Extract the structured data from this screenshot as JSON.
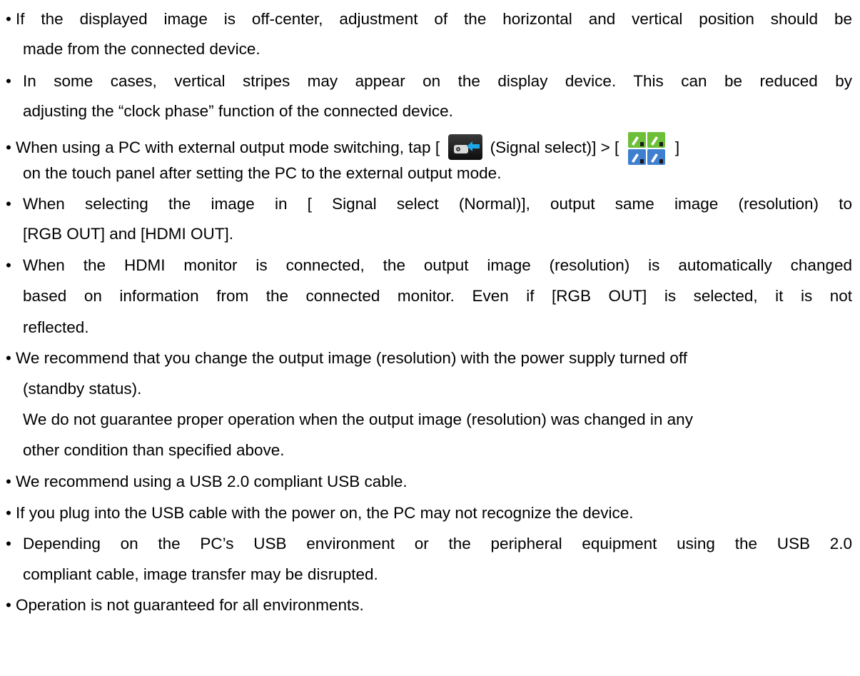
{
  "bullet": "•",
  "items": [
    {
      "lines": [
        "If the displayed image is off-center, adjustment of the horizontal and vertical position should be",
        "made from the connected device."
      ]
    },
    {
      "lines": [
        "In some cases, vertical stripes may appear on the display device. This can be reduced by",
        "adjusting the “clock phase” function of the connected device."
      ]
    },
    {
      "line1_parts": [
        "When using a PC with external output mode switching, tap [",
        "(Signal select)] > [",
        "]"
      ],
      "line2": "on the touch panel after setting the PC to the external output mode.",
      "icons": [
        "signal-select-icon",
        "signal-grid-icon"
      ]
    },
    {
      "lines": [
        "When selecting the image in [ Signal select (Normal)], output same image (resolution) to",
        "[RGB OUT] and [HDMI OUT]."
      ]
    },
    {
      "lines": [
        "When the HDMI monitor is connected, the output image (resolution) is automatically changed",
        "based on information from the connected monitor. Even if [RGB OUT] is selected, it is not",
        "reflected."
      ]
    },
    {
      "lines": [
        "We recommend that you change the output image (resolution) with the power supply turned off",
        "(standby status).",
        "We do not guarantee proper operation when the output image (resolution) was changed in any",
        "other condition than specified above."
      ]
    },
    {
      "lines": [
        "We recommend using a USB 2.0 compliant USB cable."
      ]
    },
    {
      "lines": [
        "If you plug into the USB cable with the power on, the PC may not recognize the device."
      ]
    },
    {
      "lines": [
        "Depending on the PC’s USB environment or the peripheral equipment using the USB 2.0",
        "compliant cable, image transfer may be disrupted."
      ]
    },
    {
      "lines": [
        "Operation is not guaranteed for all environments."
      ]
    }
  ]
}
